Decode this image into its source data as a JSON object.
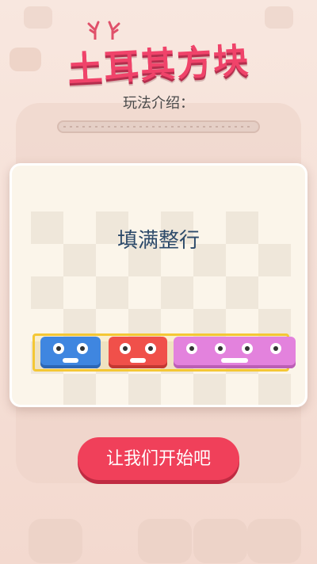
{
  "title": "土耳其方块",
  "subtitle": "玩法介绍：",
  "tutorial": {
    "heading": "填满整行"
  },
  "start_button": "让我们开始吧",
  "colors": {
    "title": "#f0436a",
    "button": "#f0405a",
    "block_blue": "#3f86e0",
    "block_red": "#f0504a",
    "block_pink": "#e382dd",
    "row_highlight": "#f4c735"
  },
  "icons": [
    "antlers-icon"
  ]
}
